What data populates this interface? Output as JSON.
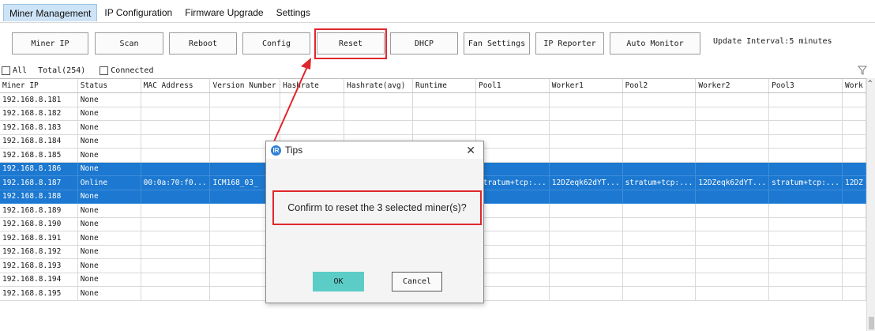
{
  "menu": {
    "items": [
      {
        "label": "Miner Management",
        "active": true
      },
      {
        "label": "IP Configuration"
      },
      {
        "label": "Firmware Upgrade"
      },
      {
        "label": "Settings"
      }
    ]
  },
  "toolbar": {
    "miner_ip": "Miner IP",
    "scan": "Scan",
    "reboot": "Reboot",
    "config": "Config",
    "reset": "Reset",
    "dhcp": "DHCP",
    "fan_settings": "Fan Settings",
    "ip_reporter": "IP Reporter",
    "auto_monitor": "Auto Monitor",
    "update_interval": "Update Interval:5 minutes"
  },
  "filters": {
    "all_label": "All",
    "total_label": "Total(254)",
    "connected_label": "Connected"
  },
  "table": {
    "headers": [
      "Miner IP",
      "Status",
      "MAC Address",
      "Version Number",
      "Hashrate",
      "Hashrate(avg)",
      "Runtime",
      "Pool1",
      "Worker1",
      "Pool2",
      "Worker2",
      "Pool3",
      "Work"
    ],
    "rows": [
      {
        "ip": "192.168.8.181",
        "status": "None"
      },
      {
        "ip": "192.168.8.182",
        "status": "None"
      },
      {
        "ip": "192.168.8.183",
        "status": "None"
      },
      {
        "ip": "192.168.8.184",
        "status": "None"
      },
      {
        "ip": "192.168.8.185",
        "status": "None"
      },
      {
        "ip": "192.168.8.186",
        "status": "None",
        "selected": true
      },
      {
        "ip": "192.168.8.187",
        "status": "Online",
        "mac": "00:0a:70:f0...",
        "version": "ICM168_03_",
        "pool1": "stratum+tcp:...",
        "worker1": "12DZeqk62dYT...",
        "pool2": "stratum+tcp:...",
        "worker2": "12DZeqk62dYT...",
        "pool3": "stratum+tcp:...",
        "worker3": "12DZ",
        "selected": true
      },
      {
        "ip": "192.168.8.188",
        "status": "None",
        "selected": true
      },
      {
        "ip": "192.168.8.189",
        "status": "None"
      },
      {
        "ip": "192.168.8.190",
        "status": "None"
      },
      {
        "ip": "192.168.8.191",
        "status": "None"
      },
      {
        "ip": "192.168.8.192",
        "status": "None"
      },
      {
        "ip": "192.168.8.193",
        "status": "None"
      },
      {
        "ip": "192.168.8.194",
        "status": "None"
      },
      {
        "ip": "192.168.8.195",
        "status": "None"
      }
    ]
  },
  "dialog": {
    "title": "Tips",
    "message": "Confirm to reset the 3 selected miner(s)?",
    "ok": "OK",
    "cancel": "Cancel"
  },
  "colors": {
    "selection": "#1c78d0",
    "highlight": "#e0262d",
    "ok_button": "#5ccdc6",
    "active_tab": "#cde3f6"
  }
}
